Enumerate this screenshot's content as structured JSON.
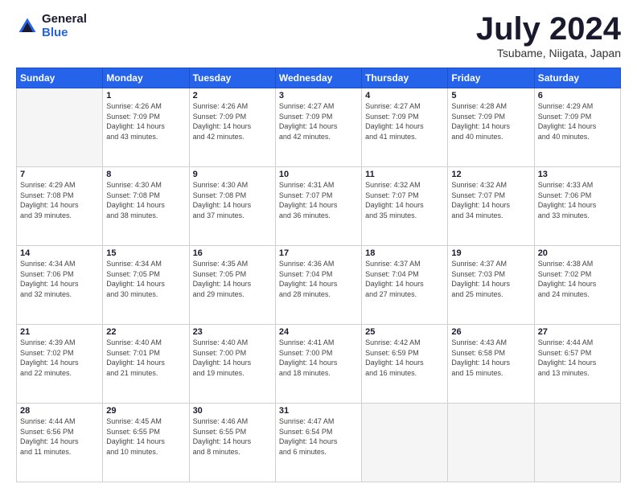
{
  "header": {
    "logo": {
      "general": "General",
      "blue": "Blue"
    },
    "title": "July 2024",
    "location": "Tsubame, Niigata, Japan"
  },
  "calendar": {
    "days": [
      "Sunday",
      "Monday",
      "Tuesday",
      "Wednesday",
      "Thursday",
      "Friday",
      "Saturday"
    ],
    "weeks": [
      [
        {
          "day": "",
          "info": ""
        },
        {
          "day": "1",
          "info": "Sunrise: 4:26 AM\nSunset: 7:09 PM\nDaylight: 14 hours\nand 43 minutes."
        },
        {
          "day": "2",
          "info": "Sunrise: 4:26 AM\nSunset: 7:09 PM\nDaylight: 14 hours\nand 42 minutes."
        },
        {
          "day": "3",
          "info": "Sunrise: 4:27 AM\nSunset: 7:09 PM\nDaylight: 14 hours\nand 42 minutes."
        },
        {
          "day": "4",
          "info": "Sunrise: 4:27 AM\nSunset: 7:09 PM\nDaylight: 14 hours\nand 41 minutes."
        },
        {
          "day": "5",
          "info": "Sunrise: 4:28 AM\nSunset: 7:09 PM\nDaylight: 14 hours\nand 40 minutes."
        },
        {
          "day": "6",
          "info": "Sunrise: 4:29 AM\nSunset: 7:09 PM\nDaylight: 14 hours\nand 40 minutes."
        }
      ],
      [
        {
          "day": "7",
          "info": "Sunrise: 4:29 AM\nSunset: 7:08 PM\nDaylight: 14 hours\nand 39 minutes."
        },
        {
          "day": "8",
          "info": "Sunrise: 4:30 AM\nSunset: 7:08 PM\nDaylight: 14 hours\nand 38 minutes."
        },
        {
          "day": "9",
          "info": "Sunrise: 4:30 AM\nSunset: 7:08 PM\nDaylight: 14 hours\nand 37 minutes."
        },
        {
          "day": "10",
          "info": "Sunrise: 4:31 AM\nSunset: 7:07 PM\nDaylight: 14 hours\nand 36 minutes."
        },
        {
          "day": "11",
          "info": "Sunrise: 4:32 AM\nSunset: 7:07 PM\nDaylight: 14 hours\nand 35 minutes."
        },
        {
          "day": "12",
          "info": "Sunrise: 4:32 AM\nSunset: 7:07 PM\nDaylight: 14 hours\nand 34 minutes."
        },
        {
          "day": "13",
          "info": "Sunrise: 4:33 AM\nSunset: 7:06 PM\nDaylight: 14 hours\nand 33 minutes."
        }
      ],
      [
        {
          "day": "14",
          "info": "Sunrise: 4:34 AM\nSunset: 7:06 PM\nDaylight: 14 hours\nand 32 minutes."
        },
        {
          "day": "15",
          "info": "Sunrise: 4:34 AM\nSunset: 7:05 PM\nDaylight: 14 hours\nand 30 minutes."
        },
        {
          "day": "16",
          "info": "Sunrise: 4:35 AM\nSunset: 7:05 PM\nDaylight: 14 hours\nand 29 minutes."
        },
        {
          "day": "17",
          "info": "Sunrise: 4:36 AM\nSunset: 7:04 PM\nDaylight: 14 hours\nand 28 minutes."
        },
        {
          "day": "18",
          "info": "Sunrise: 4:37 AM\nSunset: 7:04 PM\nDaylight: 14 hours\nand 27 minutes."
        },
        {
          "day": "19",
          "info": "Sunrise: 4:37 AM\nSunset: 7:03 PM\nDaylight: 14 hours\nand 25 minutes."
        },
        {
          "day": "20",
          "info": "Sunrise: 4:38 AM\nSunset: 7:02 PM\nDaylight: 14 hours\nand 24 minutes."
        }
      ],
      [
        {
          "day": "21",
          "info": "Sunrise: 4:39 AM\nSunset: 7:02 PM\nDaylight: 14 hours\nand 22 minutes."
        },
        {
          "day": "22",
          "info": "Sunrise: 4:40 AM\nSunset: 7:01 PM\nDaylight: 14 hours\nand 21 minutes."
        },
        {
          "day": "23",
          "info": "Sunrise: 4:40 AM\nSunset: 7:00 PM\nDaylight: 14 hours\nand 19 minutes."
        },
        {
          "day": "24",
          "info": "Sunrise: 4:41 AM\nSunset: 7:00 PM\nDaylight: 14 hours\nand 18 minutes."
        },
        {
          "day": "25",
          "info": "Sunrise: 4:42 AM\nSunset: 6:59 PM\nDaylight: 14 hours\nand 16 minutes."
        },
        {
          "day": "26",
          "info": "Sunrise: 4:43 AM\nSunset: 6:58 PM\nDaylight: 14 hours\nand 15 minutes."
        },
        {
          "day": "27",
          "info": "Sunrise: 4:44 AM\nSunset: 6:57 PM\nDaylight: 14 hours\nand 13 minutes."
        }
      ],
      [
        {
          "day": "28",
          "info": "Sunrise: 4:44 AM\nSunset: 6:56 PM\nDaylight: 14 hours\nand 11 minutes."
        },
        {
          "day": "29",
          "info": "Sunrise: 4:45 AM\nSunset: 6:55 PM\nDaylight: 14 hours\nand 10 minutes."
        },
        {
          "day": "30",
          "info": "Sunrise: 4:46 AM\nSunset: 6:55 PM\nDaylight: 14 hours\nand 8 minutes."
        },
        {
          "day": "31",
          "info": "Sunrise: 4:47 AM\nSunset: 6:54 PM\nDaylight: 14 hours\nand 6 minutes."
        },
        {
          "day": "",
          "info": ""
        },
        {
          "day": "",
          "info": ""
        },
        {
          "day": "",
          "info": ""
        }
      ]
    ]
  }
}
